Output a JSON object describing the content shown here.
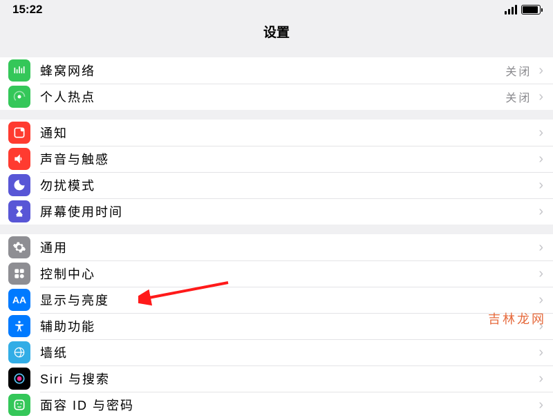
{
  "status": {
    "time": "15:22"
  },
  "header": {
    "title": "设置"
  },
  "groups": [
    {
      "rows": [
        {
          "icon": "cellular-icon",
          "label": "蜂窝网络",
          "value": "关闭"
        },
        {
          "icon": "hotspot-icon",
          "label": "个人热点",
          "value": "关闭"
        }
      ]
    },
    {
      "rows": [
        {
          "icon": "notifications-icon",
          "label": "通知"
        },
        {
          "icon": "sounds-icon",
          "label": "声音与触感"
        },
        {
          "icon": "dnd-icon",
          "label": "勿扰模式"
        },
        {
          "icon": "screentime-icon",
          "label": "屏幕使用时间"
        }
      ]
    },
    {
      "rows": [
        {
          "icon": "general-icon",
          "label": "通用"
        },
        {
          "icon": "control-center-icon",
          "label": "控制中心"
        },
        {
          "icon": "display-icon",
          "label": "显示与亮度"
        },
        {
          "icon": "accessibility-icon",
          "label": "辅助功能"
        },
        {
          "icon": "wallpaper-icon",
          "label": "墙纸",
          "highlighted": true
        },
        {
          "icon": "siri-icon",
          "label": "Siri 与搜索"
        },
        {
          "icon": "faceid-icon",
          "label": "面容 ID 与密码"
        }
      ]
    }
  ],
  "watermark": "吉林龙网"
}
